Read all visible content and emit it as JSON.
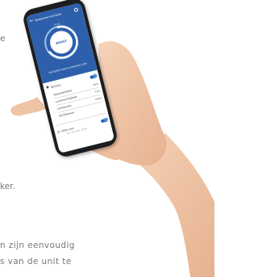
{
  "background_text": {
    "line_e": "e",
    "line_ker": "ker.",
    "line1": "n zijn eenvoudig",
    "line2": "s van de unit te"
  },
  "phone": {
    "app_title": "Badkamerventilator",
    "dial_label": "14:22",
    "boost_label": "BOOST",
    "status_line": "VOLGENDE VENTILATIENIVEAU: 60%",
    "sensors": {
      "label": "Sensors",
      "enabled": true
    },
    "settings": [
      {
        "label": "Basisventilatie",
        "value": "45%"
      },
      {
        "label": "Luchtvochtigheid",
        "value": "75%"
      },
      {
        "label": "Lichtsensor",
        "value": "100%"
      },
      {
        "label": "Vochtsensor",
        "value": ""
      }
    ],
    "schedule": {
      "label": "Stille uren",
      "sub": "ma - vr   07:00 - 22:00"
    }
  },
  "icons": {
    "back": "back-arrow-icon",
    "power": "power-icon",
    "sensors": "eye-icon",
    "schedule": "clock-icon"
  },
  "colors": {
    "app_blue": "#2d5fab",
    "dial_ring": "#9fc2ec",
    "toggle_accent": "#4a90e2",
    "skin": "#f1c7a9"
  }
}
